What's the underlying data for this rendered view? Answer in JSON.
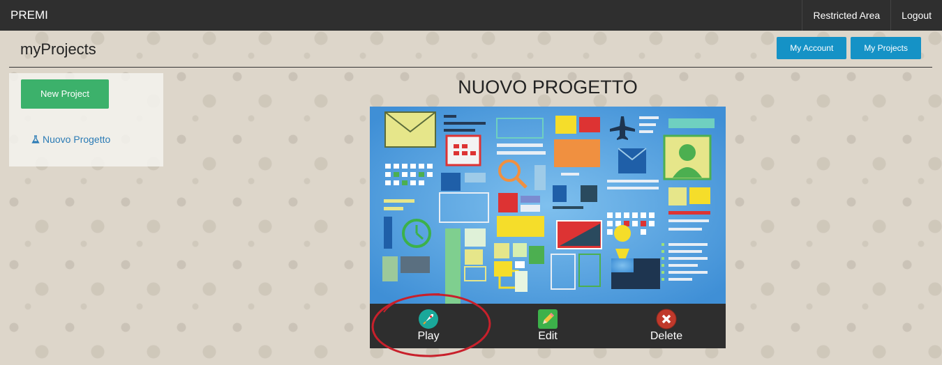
{
  "navbar": {
    "brand": "PREMI",
    "links": [
      "Restricted Area",
      "Logout"
    ]
  },
  "header": {
    "title": "myProjects",
    "buttons": [
      "My Account",
      "My Projects"
    ]
  },
  "sidebar": {
    "new_project_label": "New Project",
    "projects": [
      "Nuovo Progetto"
    ]
  },
  "project": {
    "title": "NUOVO PROGETTO",
    "actions": {
      "play": "Play",
      "edit": "Edit",
      "delete": "Delete"
    }
  },
  "colors": {
    "navbar": "#2f2f2f",
    "accent_blue": "#1592c6",
    "accent_green": "#3cb16b",
    "link": "#2b7bb5",
    "highlight_circle": "#c8202b"
  }
}
